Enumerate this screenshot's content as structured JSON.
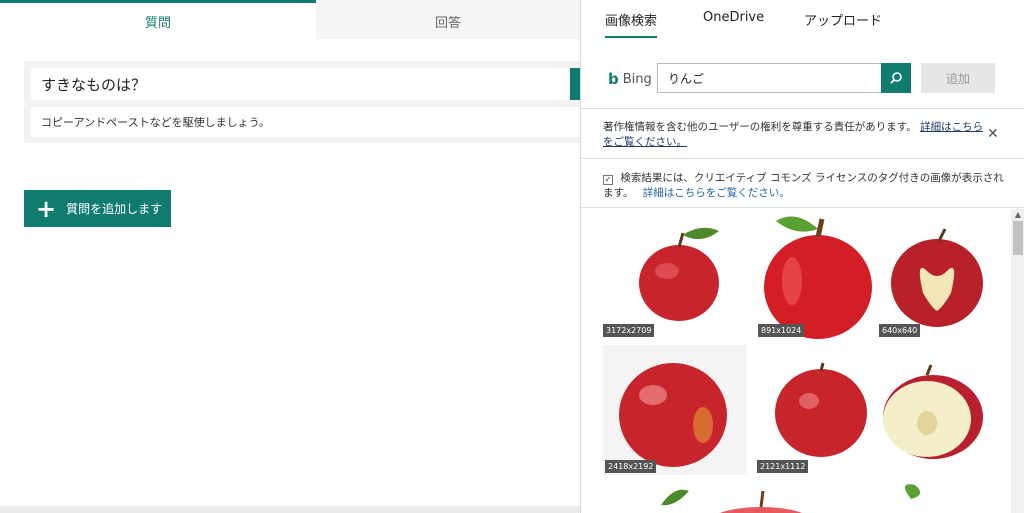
{
  "form": {
    "tabs": [
      {
        "label": "質問"
      },
      {
        "label": "回答"
      }
    ],
    "question_title": "すきなものは？",
    "question_subtitle": "コピーアンドペーストなどを駆使しましょう。",
    "add_question_label": "質問を追加します"
  },
  "panel": {
    "tabs": [
      {
        "label": "画像検索"
      },
      {
        "label": "OneDrive"
      },
      {
        "label": "アップロード"
      }
    ],
    "bing_label": "Bing",
    "search_value": "りんご",
    "add_label": "追加",
    "notice_text": "著作権情報を含む他のユーザーの権利を尊重する責任があります。",
    "notice_link": "詳細はこちらをご覧ください。",
    "cc_text": "検索結果には、クリエイティブ コモンズ ライセンスのタグ付きの画像が表示されます。",
    "cc_link": "詳細はこちらをご覧ください。"
  },
  "images": [
    {
      "size": "3172x2709",
      "desc": "red apple with leaf"
    },
    {
      "size": "891x1024",
      "desc": "cartoon red apple"
    },
    {
      "size": "640x640",
      "desc": "apple with heart cutout"
    },
    {
      "size": "2418x2192",
      "desc": "shiny red apple"
    },
    {
      "size": "2121x1112",
      "desc": "whole and cut apple"
    }
  ],
  "colors": {
    "accent": "#107c6f",
    "apple": "#c8242b"
  }
}
